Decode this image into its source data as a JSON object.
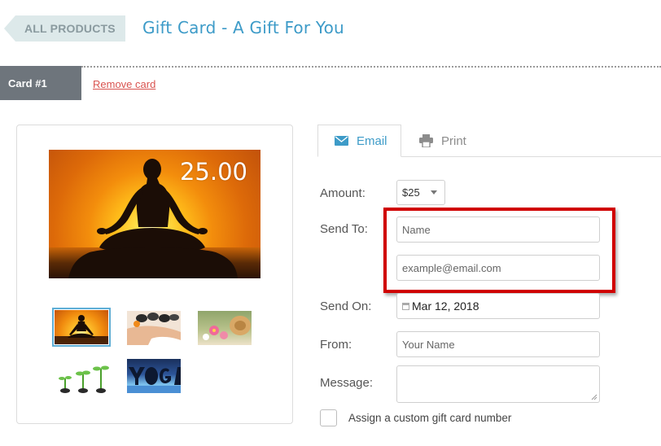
{
  "header": {
    "back_label": "ALL PRODUCTS",
    "title": "Gift Card - A Gift For You"
  },
  "card_row": {
    "card_label": "Card #1",
    "remove_label": "Remove card"
  },
  "preview": {
    "amount_overlay": "25.00",
    "thumbnails": [
      {
        "name": "meditation-sunset",
        "selected": true
      },
      {
        "name": "spa-massage",
        "selected": false
      },
      {
        "name": "yoga-mat-flowers",
        "selected": false
      },
      {
        "name": "sprouts",
        "selected": false
      },
      {
        "name": "yoga-letters",
        "selected": false
      }
    ]
  },
  "tabs": {
    "email": "Email",
    "print": "Print",
    "active": "email"
  },
  "form": {
    "amount_label": "Amount:",
    "amount_value": "$25",
    "send_to_label": "Send To:",
    "name_placeholder": "Name",
    "email_placeholder": "example@email.com",
    "send_on_label": "Send On:",
    "send_on_value": "Mar 12, 2018",
    "from_label": "From:",
    "from_placeholder": "Your Name",
    "message_label": "Message:",
    "custom_number_label": "Assign a custom gift card number"
  },
  "colors": {
    "accent": "#3d9bc8",
    "card_tab": "#6e757c",
    "remove_link": "#d9534f",
    "highlight": "#d00000"
  },
  "icons": {
    "email_tab": "envelope-icon",
    "print_tab": "printer-icon",
    "send_on": "calendar-icon"
  }
}
